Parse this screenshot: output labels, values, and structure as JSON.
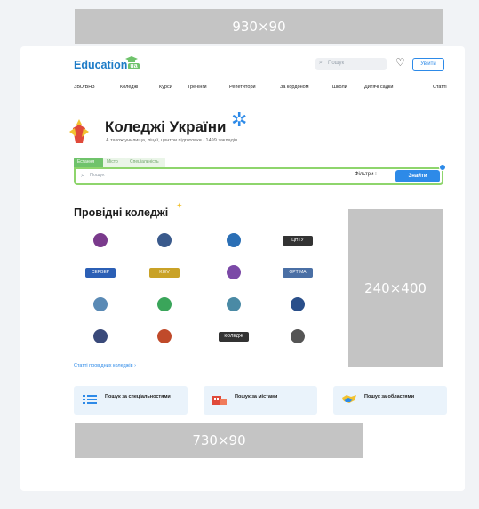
{
  "ads": {
    "top": "930×90",
    "side": "240×400",
    "bottom": "730×90"
  },
  "header": {
    "logo_text": "Education",
    "logo_badge": "ua",
    "search_placeholder": "Пошук",
    "login_label": "Увійти"
  },
  "nav": {
    "items": [
      "ЗВО/ВНЗ",
      "Коледжі",
      "Курси",
      "Тренінги",
      "Репетитори",
      "За кордоном",
      "Школи",
      "Дитячі садки",
      "Статті"
    ],
    "active_index": 1
  },
  "main": {
    "title": "Коледжі України",
    "subtitle": "А також училища, ліцеї, центри підготовки · 1499 закладів",
    "tabs": [
      "Естання",
      "Місто",
      "Спеціальність"
    ],
    "search_placeholder": "Пошук",
    "filters_label": "Фільтри",
    "find_label": "Знайти"
  },
  "featured": {
    "title": "Провідні коледжі",
    "logos": [
      {
        "shape": "circle",
        "color": "#7a3a8c"
      },
      {
        "shape": "circle",
        "color": "#3a5a8c"
      },
      {
        "shape": "circle",
        "color": "#2b6fb5"
      },
      {
        "shape": "text",
        "text": "ЦНТУ",
        "color": "#333333"
      },
      {
        "shape": "rect",
        "text": "СЕРВЕР",
        "color": "#2b5fb5"
      },
      {
        "shape": "rect",
        "text": "KIEV",
        "color": "#c9a227"
      },
      {
        "shape": "circle",
        "color": "#7b49a7"
      },
      {
        "shape": "rect",
        "text": "OPTIMA",
        "color": "#4a6fa5"
      },
      {
        "shape": "circle",
        "color": "#5a8ab5"
      },
      {
        "shape": "circle",
        "color": "#3aa55a"
      },
      {
        "shape": "circle",
        "color": "#4a8aa5"
      },
      {
        "shape": "circle",
        "color": "#2a4f8a"
      },
      {
        "shape": "circle",
        "color": "#3a4a7a"
      },
      {
        "shape": "circle",
        "color": "#c04a2a"
      },
      {
        "shape": "rect",
        "text": "КОЛЕДЖ",
        "color": "#333333"
      },
      {
        "shape": "circle",
        "color": "#555555"
      }
    ],
    "link_all": "Статті провідних коледжів ›"
  },
  "cards": [
    {
      "label": "Пошук за спеціальностями",
      "icon": "list-icon",
      "color": "#2d8ae8"
    },
    {
      "label": "Пошук за містами",
      "icon": "city-icon",
      "color": "#e04a3a"
    },
    {
      "label": "Пошук за областями",
      "icon": "map-icon",
      "color": "#2d8ae8"
    }
  ]
}
